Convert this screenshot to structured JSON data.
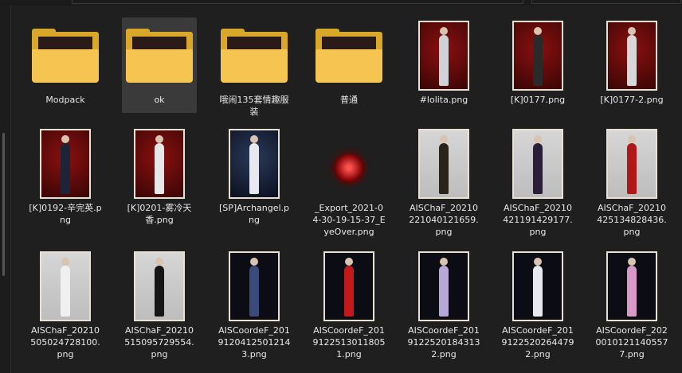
{
  "items": [
    {
      "label": "Modpack",
      "kind": "folder"
    },
    {
      "label": "ok",
      "kind": "folder",
      "selected": true
    },
    {
      "label": "哦闹135套情趣服装",
      "kind": "folder"
    },
    {
      "label": "普通",
      "kind": "folder"
    },
    {
      "label": "#lolita.png",
      "kind": "image",
      "bg": "red",
      "fig": "#cfd3d8"
    },
    {
      "label": "[K]0177.png",
      "kind": "image",
      "bg": "red",
      "fig": "#2a2a2a"
    },
    {
      "label": "[K]0177-2.png",
      "kind": "image",
      "bg": "red",
      "fig": "#d8d8d8"
    },
    {
      "label": "[K]0192-辛完英.png",
      "kind": "image",
      "bg": "red",
      "fig": "#1e2438"
    },
    {
      "label": "[K]0201-雾冷天香.png",
      "kind": "image",
      "bg": "red",
      "fig": "#e8e8e8"
    },
    {
      "label": "[SP]Archangel.png",
      "kind": "image",
      "bg": "night",
      "fig": "#e6e9f0"
    },
    {
      "label": "_Export_2021-04-30-19-15-37_EyeOver.png",
      "kind": "eye"
    },
    {
      "label": "AISChaF_20210221040121659.png",
      "kind": "image",
      "bg": "grey",
      "fig": "#2a2418"
    },
    {
      "label": "AISChaF_20210421191429177.png",
      "kind": "image",
      "bg": "grey",
      "fig": "#2b1e38"
    },
    {
      "label": "AISChaF_20210425134828436.png",
      "kind": "image",
      "bg": "grey",
      "fig": "#b01818"
    },
    {
      "label": "AISChaF_20210505024728100.png",
      "kind": "image",
      "bg": "grey",
      "fig": "#f0f0f0"
    },
    {
      "label": "AISChaF_20210515095729554.png",
      "kind": "image",
      "bg": "grey",
      "fig": "#161616"
    },
    {
      "label": "AISCoordeF_20191204125012143.png",
      "kind": "image",
      "bg": "dark",
      "fig": "#3a4a7a"
    },
    {
      "label": "AISCoordeF_20191225130118051.png",
      "kind": "image",
      "bg": "dark",
      "fig": "#c21a1a"
    },
    {
      "label": "AISCoordeF_20191225201843132.png",
      "kind": "image",
      "bg": "dark",
      "fig": "#b7a8d8"
    },
    {
      "label": "AISCoordeF_20191225202644792.png",
      "kind": "image",
      "bg": "dark",
      "fig": "#e8e8f0"
    },
    {
      "label": "AISCoordeF_20200101211405577.png",
      "kind": "image",
      "bg": "dark",
      "fig": "#d898c8"
    }
  ]
}
